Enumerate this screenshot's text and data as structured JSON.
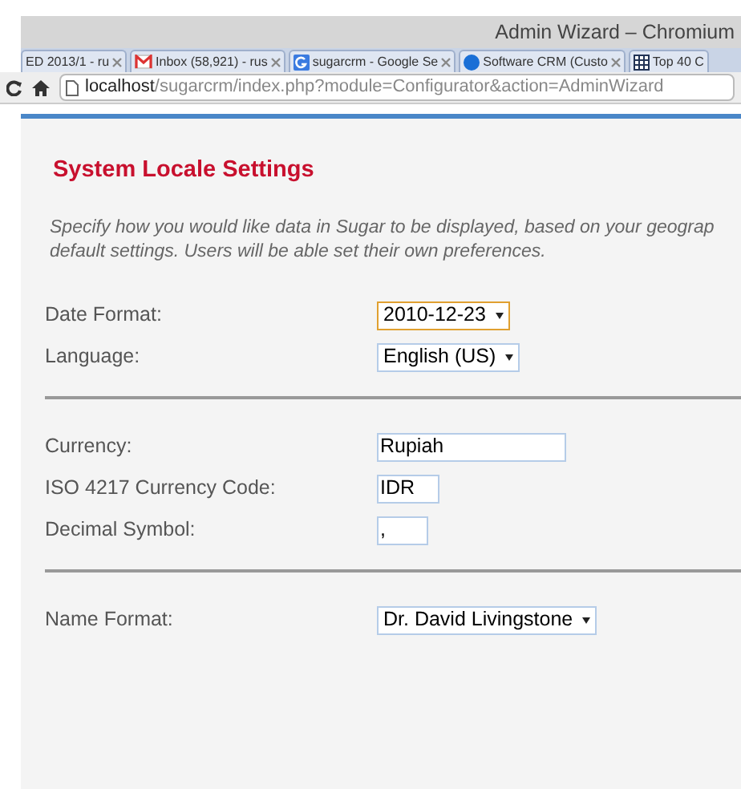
{
  "window": {
    "title": "Admin Wizard – Chromium"
  },
  "tabs": [
    {
      "label": "ED 2013/1 - ru"
    },
    {
      "label": "Inbox (58,921) - rus"
    },
    {
      "label": "sugarcrm - Google Se"
    },
    {
      "label": "Software CRM (Custo"
    },
    {
      "label": "Top 40 C"
    }
  ],
  "address_bar": {
    "host": "localhost",
    "path": "/sugarcrm/index.php?module=Configurator&action=AdminWizard"
  },
  "heading": "System Locale Settings",
  "description": [
    "Specify how you would like data in Sugar to be displayed, based on your geograp",
    "default settings. Users will be able set their own preferences."
  ],
  "sections": [
    {
      "fields": [
        {
          "label": "Date Format:",
          "kind": "select",
          "value": "2010-12-23",
          "focused": true
        },
        {
          "label": "Language:",
          "kind": "select",
          "value": "English (US)",
          "focused": false
        }
      ]
    },
    {
      "fields": [
        {
          "label": "Currency:",
          "kind": "text",
          "value": "Rupiah"
        },
        {
          "label": "ISO 4217 Currency Code:",
          "kind": "text",
          "value": "IDR"
        },
        {
          "label": "Decimal Symbol:",
          "kind": "text",
          "value": ","
        }
      ]
    },
    {
      "fields": [
        {
          "label": "Name Format:",
          "kind": "select",
          "value": "Dr. David Livingstone",
          "focused": false
        }
      ]
    }
  ]
}
